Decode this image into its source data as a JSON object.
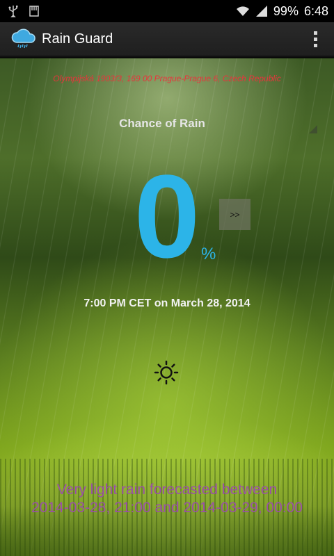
{
  "status_bar": {
    "battery": "99%",
    "time": "6:48"
  },
  "action_bar": {
    "title": "Rain Guard",
    "app_icon": "cloud-rain-icon",
    "menu_icon": "overflow-menu-icon"
  },
  "main": {
    "address": "Olympijská 1903/3, 169 00 Prague-Prague 6, Czech Republic",
    "label": "Chance of Rain",
    "chance_value": "0",
    "percent_sign": "%",
    "next_button_label": ">>",
    "time_text": "7:00 PM CET on March 28, 2014",
    "weather_icon": "sun-icon",
    "forecast_line1": "Very light rain forecasted between",
    "forecast_line2": "2014-03-28, 21:00 and 2014-03-29, 00:00"
  },
  "colors": {
    "accent_blue": "#2cb4e8",
    "address_red": "#e8343c",
    "forecast_purple": "#9a4fa8"
  }
}
